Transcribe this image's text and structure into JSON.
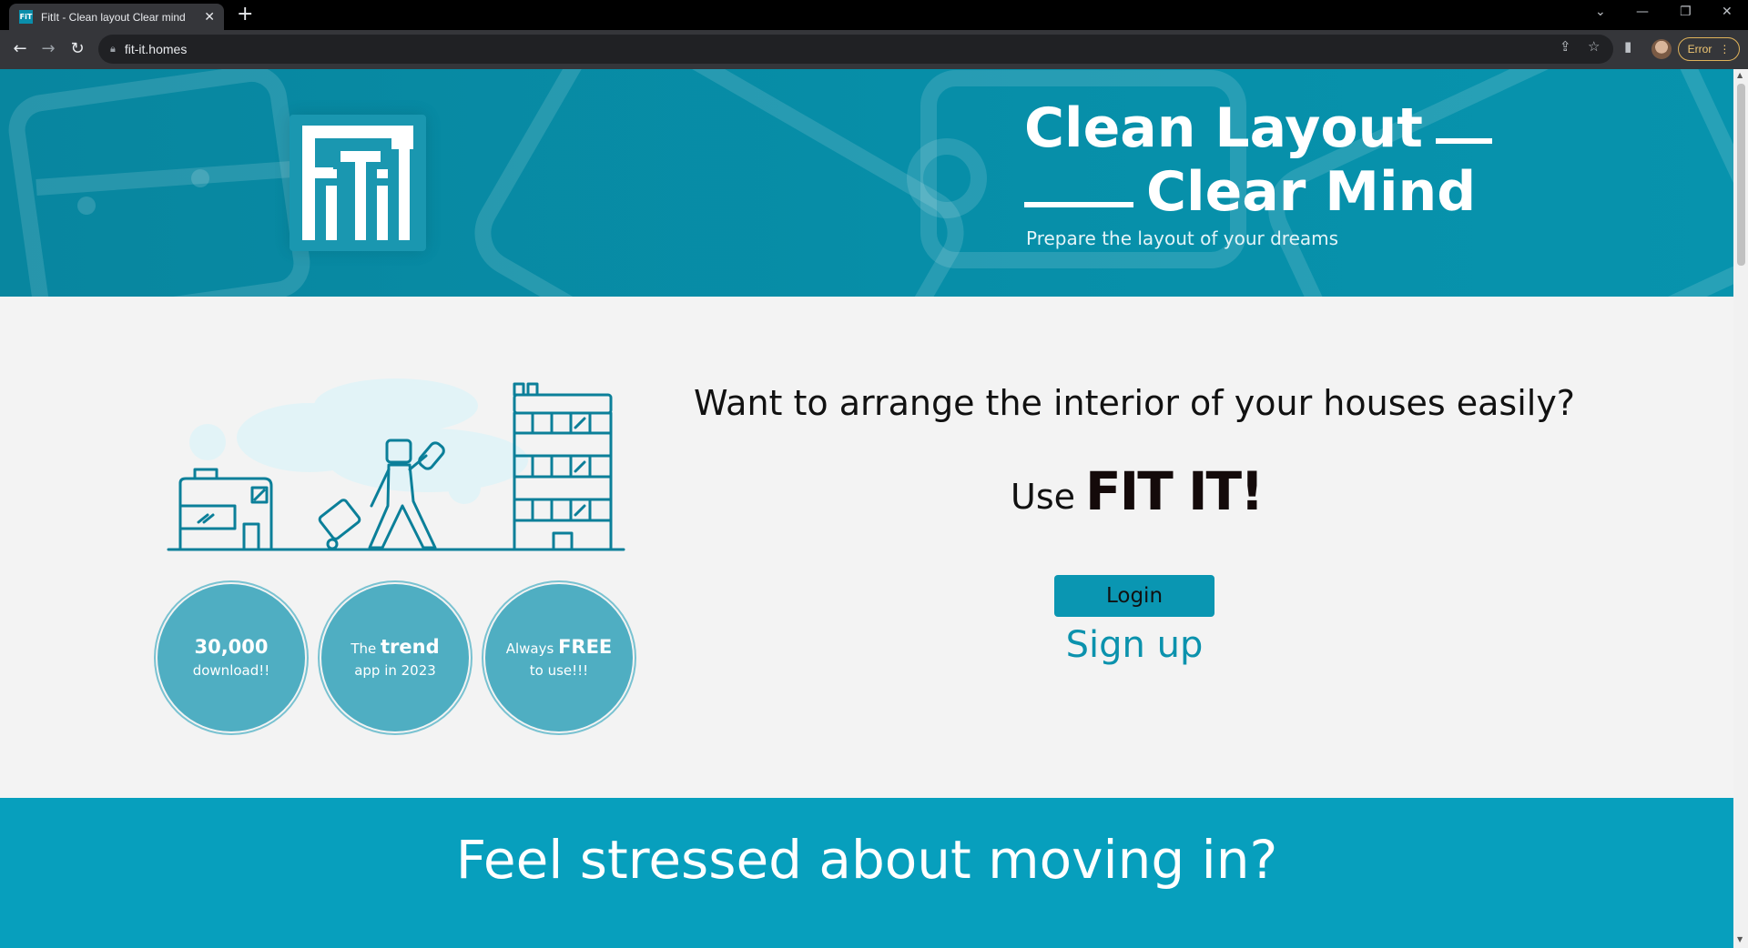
{
  "browser": {
    "tab_title": "FitIt - Clean layout Clear mind",
    "tab_favicon_text": "FiT",
    "url": "fit-it.homes",
    "profile_error_label": "Error"
  },
  "hero": {
    "logo_text": "FiTiT",
    "title_line1": "Clean Layout",
    "title_line2": "Clear Mind",
    "subtitle": "Prepare the layout of your dreams"
  },
  "stats": [
    {
      "line1_bold": "30,000",
      "line1_light": "",
      "line2": "download!!"
    },
    {
      "line1_light": "The ",
      "line1_bold": "trend",
      "line2": "app in 2023"
    },
    {
      "line1_light": "Always ",
      "line1_bold": "FREE",
      "line2": "to use!!!"
    }
  ],
  "cta": {
    "question": "Want to arrange the interior of your houses easily?",
    "use_prefix": "Use",
    "brand": "FIT IT!",
    "login_label": "Login",
    "signup_label": "Sign up"
  },
  "band": {
    "title": "Feel stressed about moving in?"
  },
  "colors": {
    "brand_teal": "#078fa9",
    "button_teal": "#0a96b2",
    "circle_teal": "#4faec2",
    "band_teal": "#079fbd"
  }
}
